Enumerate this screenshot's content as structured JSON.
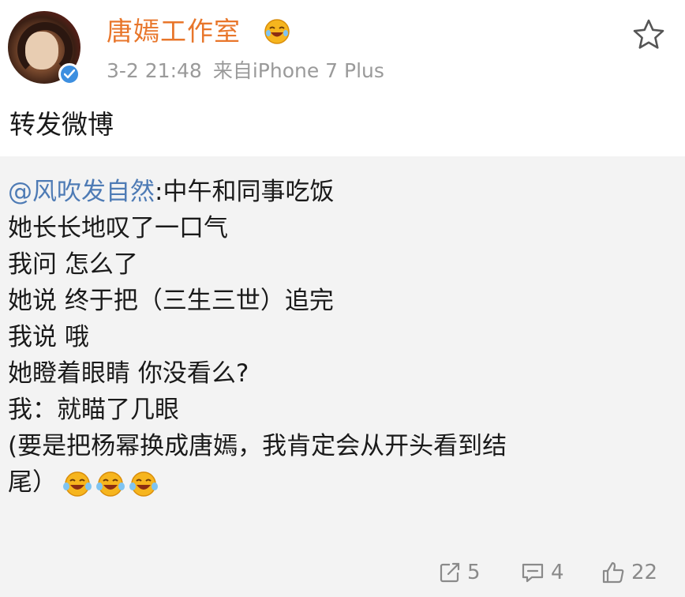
{
  "post": {
    "author": {
      "name": "唐嫣工作室",
      "verified": true,
      "badge_color": "#3d8fe0",
      "name_color": "#e8762b",
      "member_icon": "laughing-emoji-icon"
    },
    "time": "3-2 21:48",
    "source": "来自iPhone 7 Plus",
    "text": "转发微博",
    "favorite_icon": "star-icon"
  },
  "retweet": {
    "mention": "@风吹发自然",
    "lines": [
      ":中午和同事吃饭",
      "她长长地叹了一口气",
      "我问 怎么了",
      "她说 终于把（三生三世）追完",
      "我说 哦",
      "她瞪着眼睛 你没看么?",
      "我：就瞄了几眼",
      "(要是把杨幂换成唐嫣，我肯定会从开头看到结",
      "尾）"
    ],
    "emoji": [
      "laughing-emoji-icon",
      "laughing-emoji-icon",
      "laughing-emoji-icon"
    ]
  },
  "actions": {
    "repost": {
      "icon": "repost-icon",
      "count": "5"
    },
    "comment": {
      "icon": "comment-icon",
      "count": "4"
    },
    "like": {
      "icon": "thumbs-up-icon",
      "count": "22"
    }
  }
}
